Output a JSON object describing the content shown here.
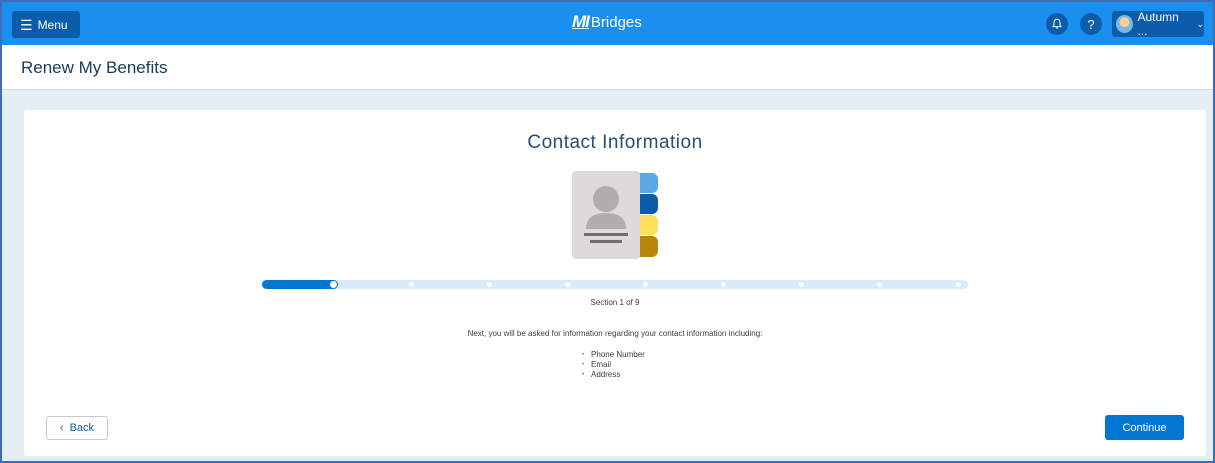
{
  "header": {
    "menu_label": "Menu",
    "brand_mark": "MI",
    "brand_name": "Bridges",
    "user_name": "Autumn ...",
    "help_label": "?"
  },
  "page": {
    "title": "Renew My Benefits"
  },
  "card": {
    "title": "Contact Information",
    "progress": {
      "current_section": 1,
      "total_sections": 9,
      "label": "Section 1 of 9"
    },
    "intro": "Next, you will be asked for information regarding your contact information including:",
    "items": [
      "Phone Number",
      "Email",
      "Address"
    ],
    "back_label": "Back",
    "continue_label": "Continue"
  },
  "icons": {
    "menu": "hamburger-icon",
    "bell": "bell-icon",
    "help": "help-icon",
    "chevron": "chevron-down-icon",
    "back": "chevron-left-icon",
    "illustration": "contact-book-icon"
  },
  "colors": {
    "header_bg": "#1a8ff0",
    "button_dark": "#0b5cab",
    "primary": "#0176d3",
    "progress_track": "#d9ebfb",
    "tab_light_blue": "#5aa9e6",
    "tab_dark_blue": "#0b5cab",
    "tab_yellow": "#ffde5a",
    "tab_gold": "#b5860b"
  }
}
